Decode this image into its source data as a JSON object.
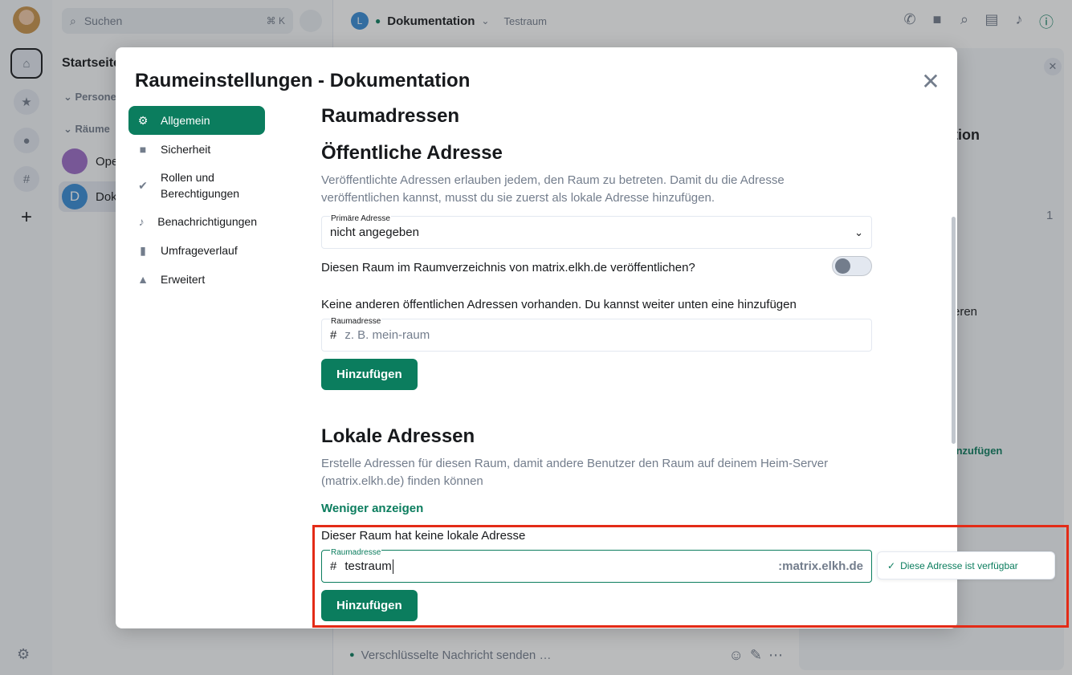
{
  "search": {
    "placeholder": "Suchen",
    "shortcut": "⌘ K"
  },
  "roomlist": {
    "title": "Startseite",
    "section_people": "Personen",
    "section_rooms": "Räume",
    "rooms": [
      {
        "initial": "",
        "name": "Ope"
      },
      {
        "initial": "D",
        "name": "Dok"
      }
    ]
  },
  "header": {
    "avatar_initial": "L",
    "room_name": "Dokumentation",
    "topic": "Testraum"
  },
  "right_panel": {
    "title_fragment": "tion",
    "count": "1",
    "text_fragment": "eren",
    "link_fragment": "inzufügen"
  },
  "composer": {
    "placeholder": "Verschlüsselte Nachricht senden …"
  },
  "dialog": {
    "title": "Raumeinstellungen - Dokumentation",
    "tabs": [
      {
        "label": "Allgemein",
        "icon": "gear-icon",
        "active": true
      },
      {
        "label": "Sicherheit",
        "icon": "lock-icon"
      },
      {
        "label": "Rollen und Berechtigungen",
        "icon": "shield-check-icon"
      },
      {
        "label": "Benachrichtigungen",
        "icon": "bell-icon"
      },
      {
        "label": "Umfrageverlauf",
        "icon": "poll-icon"
      },
      {
        "label": "Erweitert",
        "icon": "warning-icon"
      }
    ],
    "section_title": "Raumadressen",
    "public": {
      "heading": "Öffentliche Adresse",
      "description": "Veröffentlichte Adressen erlauben jedem, den Raum zu betreten. Damit du die Adresse veröffentlichen kannst, musst du sie zuerst als lokale Adresse hinzufügen.",
      "primary_label": "Primäre Adresse",
      "primary_value": "nicht angegeben",
      "publish_question": "Diesen Raum im Raumverzeichnis von matrix.elkh.de veröffentlichen?",
      "publish_enabled": false,
      "no_other": "Keine anderen öffentlichen Adressen vorhanden. Du kannst weiter unten eine hinzufügen",
      "field_label": "Raumadresse",
      "field_placeholder": "z. B. mein-raum",
      "add_button": "Hinzufügen"
    },
    "local": {
      "heading": "Lokale Adressen",
      "description": "Erstelle Adressen für diesen Raum, damit andere Benutzer den Raum auf deinem Heim-Server (matrix.elkh.de) finden können",
      "show_less": "Weniger anzeigen",
      "none_text": "Dieser Raum hat keine lokale Adresse",
      "field_label": "Raumadresse",
      "field_value": "testraum",
      "domain_suffix": ":matrix.elkh.de",
      "add_button": "Hinzufügen",
      "availability": "Diese Adresse ist verfügbar"
    }
  },
  "colors": {
    "accent": "#0b7d5e",
    "highlight": "#e32b17"
  }
}
